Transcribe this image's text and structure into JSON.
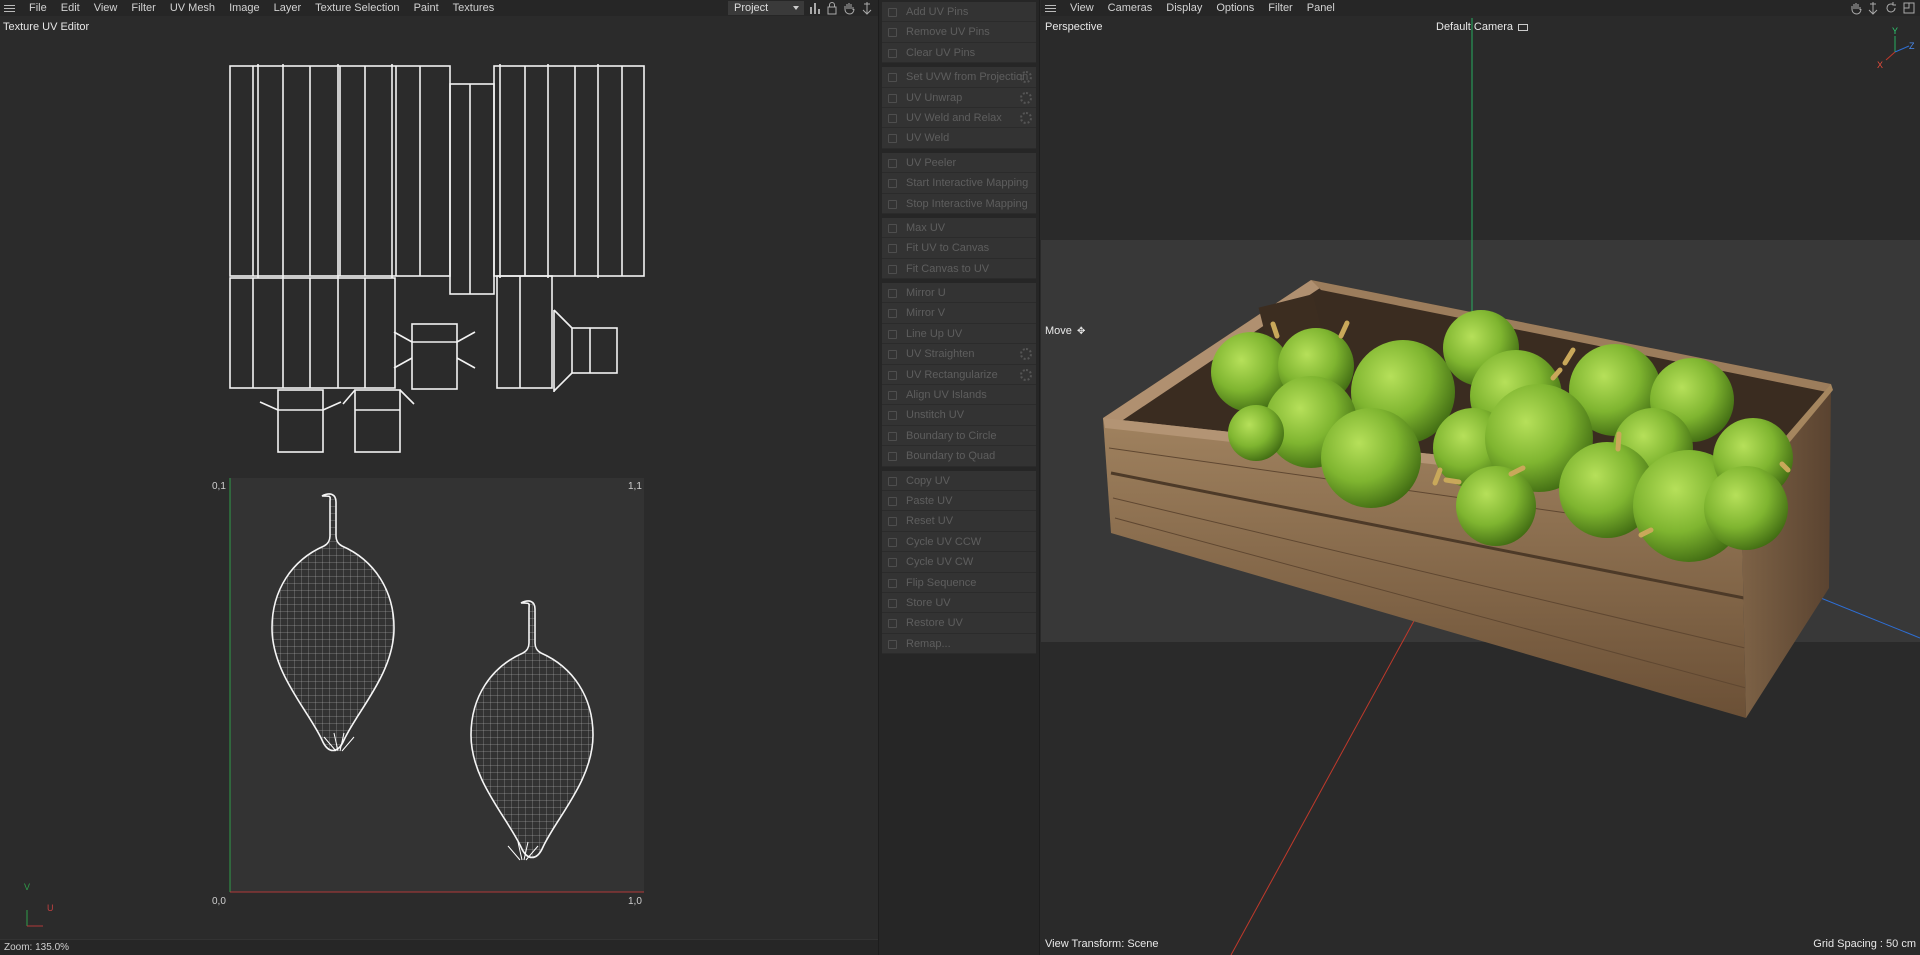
{
  "uv_editor": {
    "menu": [
      "File",
      "Edit",
      "View",
      "Filter",
      "UV Mesh",
      "Image",
      "Layer",
      "Texture Selection",
      "Paint",
      "Textures"
    ],
    "title": "Texture UV Editor",
    "project_select": "Project",
    "corner_labels": {
      "top_left": "0,1",
      "top_right": "1,1",
      "bottom_left": "0,0",
      "bottom_right": "1,0"
    },
    "axis_labels": {
      "v": "V",
      "u": "U"
    },
    "status": "Zoom: 135.0%"
  },
  "command_groups": [
    [
      {
        "label": "Add UV Pins",
        "icon": "pin-add-icon",
        "gear": false
      },
      {
        "label": "Remove UV Pins",
        "icon": "pin-remove-icon",
        "gear": false
      },
      {
        "label": "Clear UV Pins",
        "icon": "pin-clear-icon",
        "gear": false
      }
    ],
    [
      {
        "label": "Set UVW from Projection",
        "icon": "projection-icon",
        "gear": true
      },
      {
        "label": "UV Unwrap",
        "icon": "unwrap-icon",
        "gear": true
      },
      {
        "label": "UV Weld and Relax",
        "icon": "weld-relax-icon",
        "gear": true
      },
      {
        "label": "UV Weld",
        "icon": "weld-icon",
        "gear": false
      }
    ],
    [
      {
        "label": "UV Peeler",
        "icon": "peeler-icon",
        "gear": false
      },
      {
        "label": "Start Interactive Mapping",
        "icon": "play-icon",
        "gear": false
      },
      {
        "label": "Stop Interactive Mapping",
        "icon": "stop-icon",
        "gear": false
      }
    ],
    [
      {
        "label": "Max UV",
        "icon": "max-uv-icon",
        "gear": false
      },
      {
        "label": "Fit UV to Canvas",
        "icon": "fit-uv-icon",
        "gear": false
      },
      {
        "label": "Fit Canvas to UV",
        "icon": "fit-canvas-icon",
        "gear": false
      }
    ],
    [
      {
        "label": "Mirror U",
        "icon": "mirror-u-icon",
        "gear": false
      },
      {
        "label": "Mirror V",
        "icon": "mirror-v-icon",
        "gear": false
      },
      {
        "label": "Line Up UV",
        "icon": "line-up-icon",
        "gear": false
      },
      {
        "label": "UV Straighten",
        "icon": "straighten-icon",
        "gear": true
      },
      {
        "label": "UV Rectangularize",
        "icon": "rectangularize-icon",
        "gear": true
      },
      {
        "label": "Align UV Islands",
        "icon": "align-icon",
        "gear": false
      },
      {
        "label": "Unstitch UV",
        "icon": "unstitch-icon",
        "gear": false
      },
      {
        "label": "Boundary to Circle",
        "icon": "circle-icon",
        "gear": false
      },
      {
        "label": "Boundary to Quad",
        "icon": "quad-icon",
        "gear": false
      }
    ],
    [
      {
        "label": "Copy UV",
        "icon": "copy-icon",
        "gear": false
      },
      {
        "label": "Paste UV",
        "icon": "paste-icon",
        "gear": false
      },
      {
        "label": "Reset UV",
        "icon": "reset-icon",
        "gear": false
      },
      {
        "label": "Cycle UV CCW",
        "icon": "rotate-ccw-icon",
        "gear": false
      },
      {
        "label": "Cycle UV CW",
        "icon": "rotate-cw-icon",
        "gear": false
      },
      {
        "label": "Flip Sequence",
        "icon": "flip-icon",
        "gear": false
      },
      {
        "label": "Store UV",
        "icon": "store-icon",
        "gear": false
      },
      {
        "label": "Restore UV",
        "icon": "restore-icon",
        "gear": false
      },
      {
        "label": "Remap...",
        "icon": "remap-icon",
        "gear": false
      }
    ]
  ],
  "viewport": {
    "menu": [
      "View",
      "Cameras",
      "Display",
      "Options",
      "Filter",
      "Panel"
    ],
    "view_name": "Perspective",
    "camera": "Default Camera",
    "tool": "Move",
    "view_transform": "View Transform: Scene",
    "grid_spacing": "Grid Spacing : 50 cm",
    "gizmo_labels": {
      "y": "Y",
      "z": "Z",
      "x": "X"
    }
  },
  "colors": {
    "fruit_green": "#7fb530",
    "crate_wood": "#8a6b4a",
    "axis_x": "#c0392b",
    "axis_y": "#27ae60",
    "axis_z": "#2e6fd6"
  }
}
